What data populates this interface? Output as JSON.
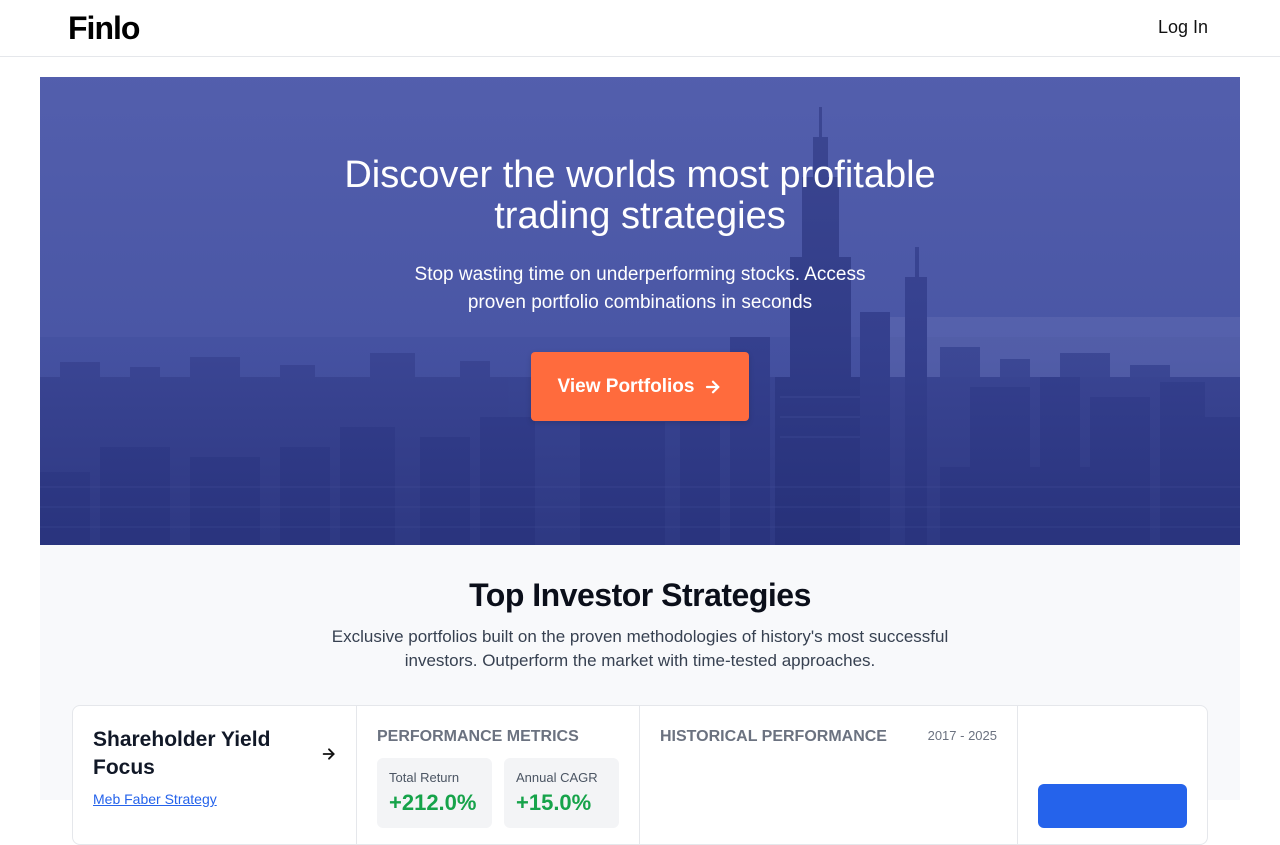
{
  "header": {
    "logo": "Finlo",
    "login_label": "Log In"
  },
  "hero": {
    "title_line1": "Discover the worlds most profitable",
    "title_line2": "trading strategies",
    "subtitle_line1": "Stop wasting time on underperforming stocks. Access",
    "subtitle_line2": "proven portfolio combinations in seconds",
    "cta_label": "View Portfolios"
  },
  "strategies": {
    "title": "Top Investor Strategies",
    "subtitle_line1": "Exclusive portfolios built on the proven methodologies of history's most successful",
    "subtitle_line2": "investors. Outperform the market with time-tested approaches.",
    "card": {
      "name": "Shareholder Yield Focus",
      "author": "Meb Faber Strategy",
      "metrics_label": "PERFORMANCE METRICS",
      "metrics": [
        {
          "label": "Total Return",
          "value": "+212.0%"
        },
        {
          "label": "Annual CAGR",
          "value": "+15.0%"
        }
      ],
      "history_label": "HISTORICAL PERFORMANCE",
      "history_years": "2017 - 2025"
    }
  },
  "colors": {
    "accent": "#ff6b3d",
    "primary": "#2563eb",
    "positive": "#16a34a"
  }
}
